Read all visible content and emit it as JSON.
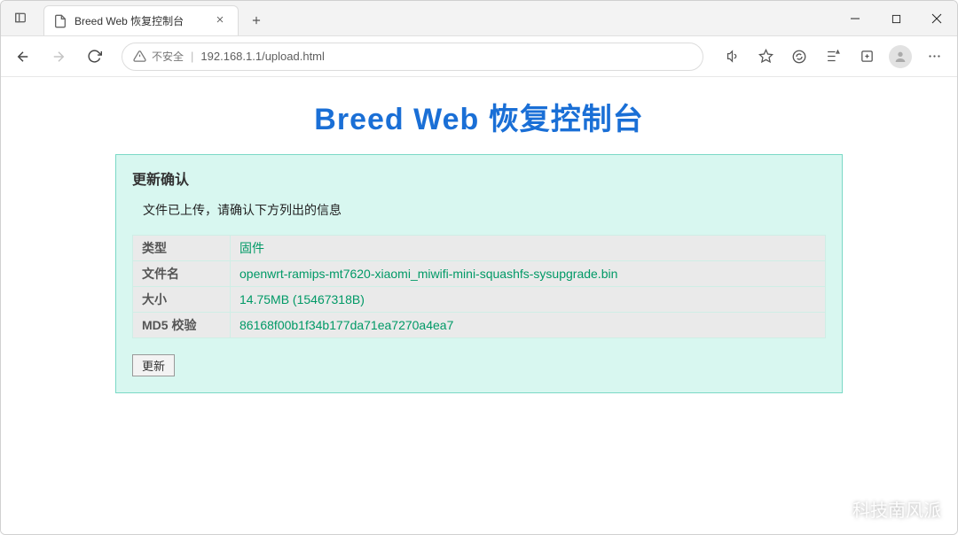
{
  "browser": {
    "tab_title": "Breed Web 恢复控制台",
    "security_label": "不安全",
    "url": "192.168.1.1/upload.html"
  },
  "page": {
    "title": "Breed Web 恢复控制台",
    "panel_heading": "更新确认",
    "note": "文件已上传，请确认下方列出的信息",
    "rows": {
      "type_label": "类型",
      "type_value": "固件",
      "filename_label": "文件名",
      "filename_value": "openwrt-ramips-mt7620-xiaomi_miwifi-mini-squashfs-sysupgrade.bin",
      "size_label": "大小",
      "size_value": "14.75MB (15467318B)",
      "md5_label": "MD5 校验",
      "md5_value": "86168f00b1f34b177da71ea7270a4ea7"
    },
    "update_button": "更新"
  },
  "watermark": {
    "text": "科技南风派"
  }
}
